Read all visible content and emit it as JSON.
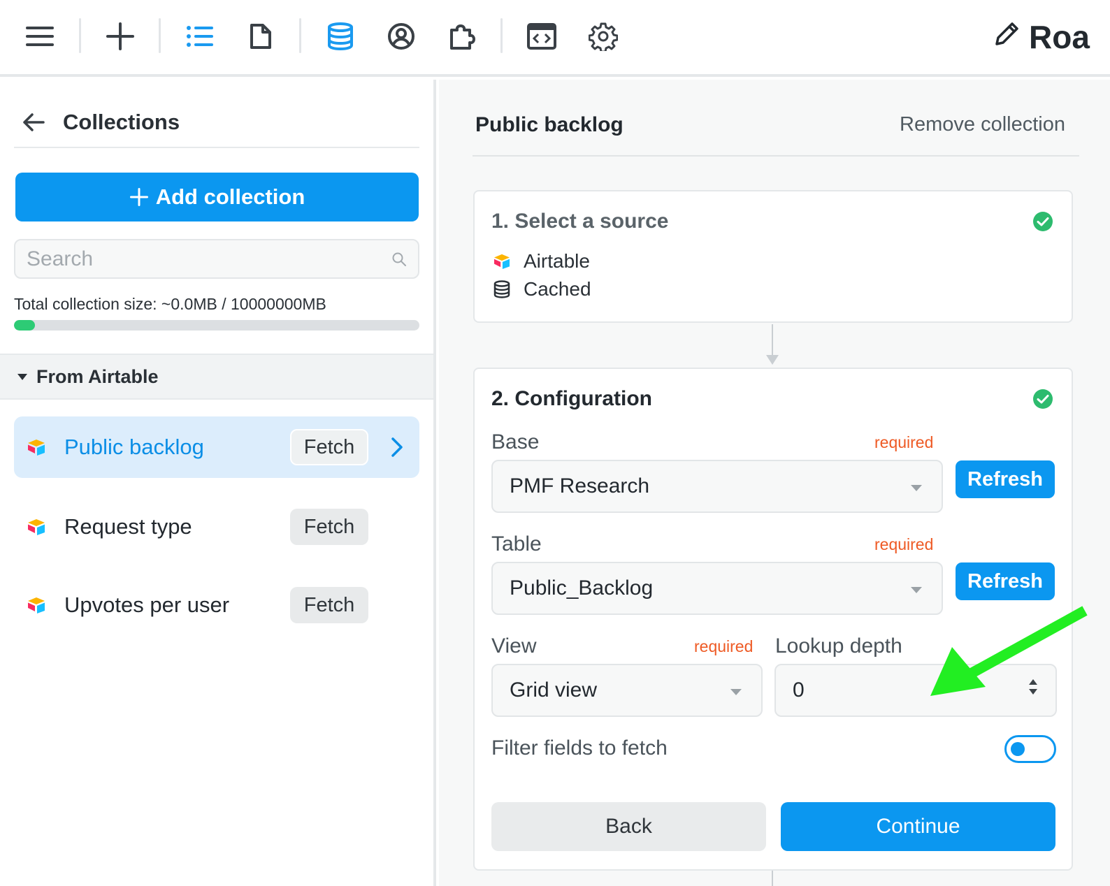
{
  "toolbar": {
    "icons": [
      "menu-icon",
      "plus-icon",
      "list-icon",
      "file-icon",
      "database-icon",
      "user-circle-icon",
      "puzzle-icon",
      "code-window-icon",
      "gear-icon",
      "pencil-icon"
    ],
    "app_title": "Roa",
    "active_color": "#1a9af0"
  },
  "sidebar": {
    "title": "Collections",
    "add_label": "Add collection",
    "search_placeholder": "Search",
    "size_label": "Total collection size: ~0.0MB / 10000000MB",
    "size_fraction": 0.0,
    "group_label": "From Airtable",
    "items": [
      {
        "name": "Public backlog",
        "action": "Fetch",
        "active": true
      },
      {
        "name": "Request type",
        "action": "Fetch",
        "active": false
      },
      {
        "name": "Upvotes per user",
        "action": "Fetch",
        "active": false
      }
    ]
  },
  "main": {
    "title": "Public backlog",
    "remove_label": "Remove collection",
    "step1": {
      "title": "1. Select a source",
      "source": "Airtable",
      "mode": "Cached"
    },
    "step2": {
      "title": "2. Configuration",
      "base_label": "Base",
      "base_value": "PMF Research",
      "table_label": "Table",
      "table_value": "Public_Backlog",
      "view_label": "View",
      "view_value": "Grid view",
      "depth_label": "Lookup depth",
      "depth_value": "0",
      "required_label": "required",
      "refresh_label": "Refresh",
      "filter_label": "Filter fields to fetch",
      "filter_on": false,
      "back_label": "Back",
      "continue_label": "Continue"
    }
  },
  "colors": {
    "primary": "#0b97f0",
    "success": "#2dbb6e",
    "required": "#ee5a24",
    "annotation": "#22ee22"
  }
}
